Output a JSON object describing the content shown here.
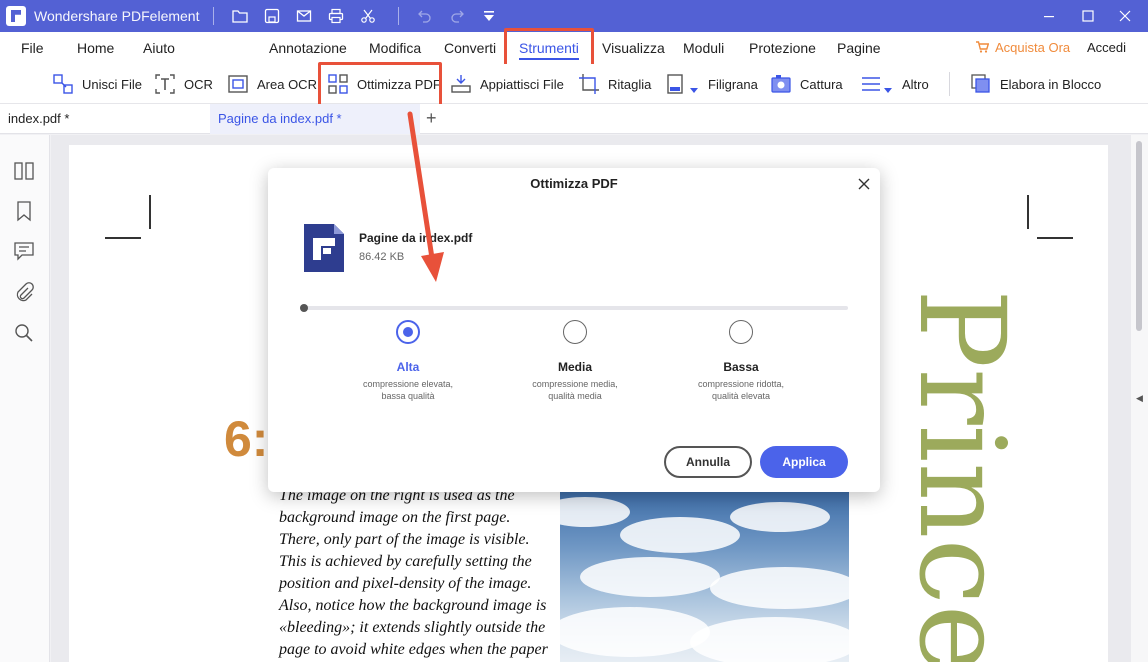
{
  "app": {
    "title": "Wondershare PDFelement"
  },
  "menu": {
    "file": "File",
    "home": "Home",
    "help": "Aiuto",
    "annotate": "Annotazione",
    "edit": "Modifica",
    "convert": "Converti",
    "tools": "Strumenti",
    "view": "Visualizza",
    "forms": "Moduli",
    "protect": "Protezione",
    "pages": "Pagine",
    "buy": "Acquista Ora",
    "login": "Accedi"
  },
  "toolbar": {
    "merge": "Unisci File",
    "ocr": "OCR",
    "ocr_area": "Area OCR",
    "optimize": "Ottimizza PDF",
    "flatten": "Appiattisci File",
    "crop": "Ritaglia",
    "watermark": "Filigrana",
    "capture": "Cattura",
    "more": "Altro",
    "batch": "Elabora in Blocco"
  },
  "tabs": [
    {
      "label": "index.pdf *"
    },
    {
      "label": "Pagine da index.pdf *"
    }
  ],
  "document": {
    "big_title": "Prince",
    "chapter": "6:",
    "body_lines": [
      "The image on the right is used as the",
      "background image on the first page.",
      "There, only part of the image is visible.",
      "This is achieved by carefully setting the",
      "position and pixel-density of the image.",
      "Also, notice how the background image is",
      "«bleeding»; it extends slightly outside the",
      "page to avoid white edges when the paper"
    ]
  },
  "dialog": {
    "title": "Ottimizza PDF",
    "file_name": "Pagine da index.pdf",
    "file_size": "86.42 KB",
    "options": [
      {
        "label": "Alta",
        "desc1": "compressione elevata,",
        "desc2": "bassa qualità",
        "selected": true
      },
      {
        "label": "Media",
        "desc1": "compressione media,",
        "desc2": "qualità media",
        "selected": false
      },
      {
        "label": "Bassa",
        "desc1": "compressione ridotta,",
        "desc2": "qualità elevata",
        "selected": false
      }
    ],
    "cancel": "Annulla",
    "apply": "Applica"
  },
  "colors": {
    "titlebar": "#5361d4",
    "accent": "#4b63ea",
    "highlight": "#e8513a",
    "buy": "#f08b3c"
  }
}
